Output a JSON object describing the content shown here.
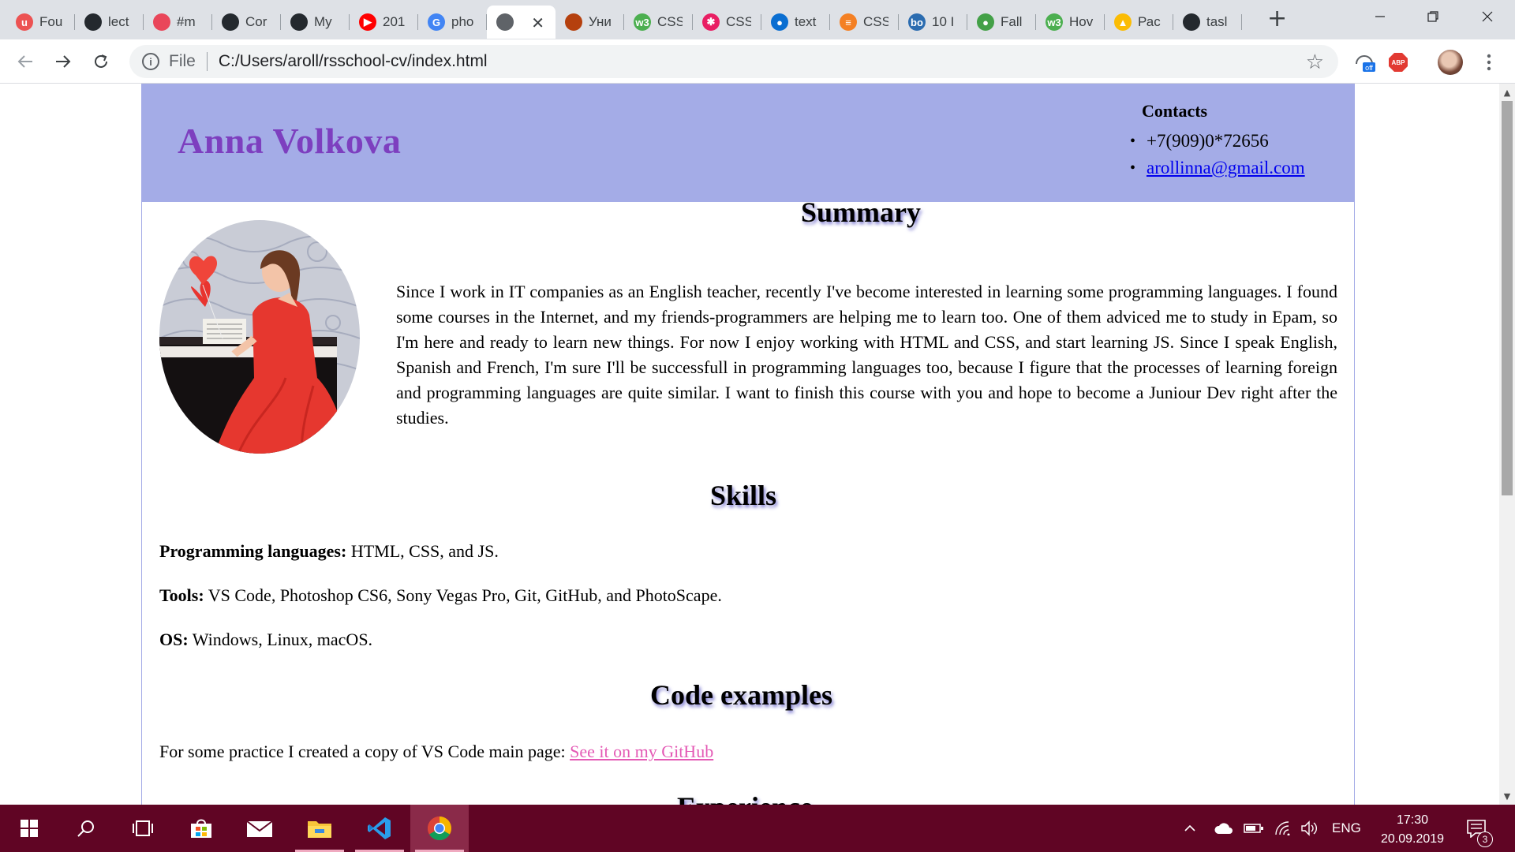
{
  "browser": {
    "tabs": [
      {
        "title": "Fou",
        "icon": "udemy-icon",
        "color": "#ec5252",
        "glyph": "u"
      },
      {
        "title": "lect",
        "icon": "github-icon",
        "color": "#24292e",
        "glyph": ""
      },
      {
        "title": "#m",
        "icon": "app-icon",
        "color": "#e9465a",
        "glyph": ""
      },
      {
        "title": "Cor",
        "icon": "github-icon",
        "color": "#24292e",
        "glyph": ""
      },
      {
        "title": "My",
        "icon": "github-icon",
        "color": "#24292e",
        "glyph": ""
      },
      {
        "title": "201",
        "icon": "youtube-icon",
        "color": "#ff0000",
        "glyph": "▶"
      },
      {
        "title": "pho",
        "icon": "google-icon",
        "color": "#4285f4",
        "glyph": "G"
      },
      {
        "title": "",
        "icon": "globe-icon",
        "color": "#5f6368",
        "glyph": "",
        "active": true
      },
      {
        "title": "Уни",
        "icon": "site-icon",
        "color": "#b5400e",
        "glyph": ""
      },
      {
        "title": "CSS",
        "icon": "w3schools-icon",
        "color": "#4caf50",
        "glyph": "w3"
      },
      {
        "title": "CSS",
        "icon": "asterisk-icon",
        "color": "#e91e63",
        "glyph": "✱"
      },
      {
        "title": "text",
        "icon": "drop-icon",
        "color": "#0a6ed1",
        "glyph": "●"
      },
      {
        "title": "CSS",
        "icon": "stackoverflow-icon",
        "color": "#f48024",
        "glyph": "≡"
      },
      {
        "title": "10 I",
        "icon": "bo-icon",
        "color": "#2b6cb0",
        "glyph": "bo"
      },
      {
        "title": "Fall",
        "icon": "leaf-icon",
        "color": "#43a047",
        "glyph": "●"
      },
      {
        "title": "Hov",
        "icon": "w3schools-icon",
        "color": "#4caf50",
        "glyph": "w3"
      },
      {
        "title": "Рас",
        "icon": "drive-icon",
        "color": "#fbbc04",
        "glyph": "▲"
      },
      {
        "title": "tasl",
        "icon": "github-icon",
        "color": "#24292e",
        "glyph": ""
      }
    ],
    "new_tab_label": "+",
    "address": {
      "scheme_label": "File",
      "url": "C:/Users/aroll/rsschool-cv/index.html"
    },
    "extensions": [
      {
        "name": "vpn-extension",
        "badge": "off"
      },
      {
        "name": "adblock-extension",
        "badge": "ABP"
      }
    ]
  },
  "cv": {
    "name": "Anna Volkova",
    "contacts": {
      "title": "Contacts",
      "phone": "+7(909)0*72656",
      "email": "arollinna@gmail.com"
    },
    "summary": {
      "title": "Summary",
      "text": "Since I work in IT companies as an English teacher, recently I've become interested in learning some programming languages. I found some courses in the Internet, and my friends-programmers are helping me to learn too. One of them adviced me to study in Epam, so I'm here and ready to learn new things. For now I enjoy working with HTML and CSS, and start learning JS. Since I speak English, Spanish and French, I'm sure I'll be successfull in programming languages too, because I figure that the processes of learning foreign and programming languages are quite similar. I want to finish this course with you and hope to become a Juniour Dev right after the studies."
    },
    "skills": {
      "title": "Skills",
      "items": [
        {
          "label": "Programming languages:",
          "value": " HTML, CSS, and JS."
        },
        {
          "label": "Tools:",
          "value": " VS Code, Photoshop CS6, Sony Vegas Pro, Git, GitHub, and PhotoScape."
        },
        {
          "label": "OS:",
          "value": " Windows, Linux, macOS."
        }
      ]
    },
    "code_examples": {
      "title": "Code examples",
      "text": "For some practice I created a copy of VS Code main page: ",
      "link_text": "See it on my GitHub"
    },
    "next_section_title_partial": "Experience"
  },
  "taskbar": {
    "language": "ENG",
    "time": "17:30",
    "date": "20.09.2019",
    "notifications_count": "3"
  },
  "colors": {
    "header_bg": "#a4ace7",
    "name_color": "#7d3fbf",
    "link_color": "#0000ee",
    "github_link_color": "#e45ab5",
    "taskbar_bg": "#600524"
  }
}
